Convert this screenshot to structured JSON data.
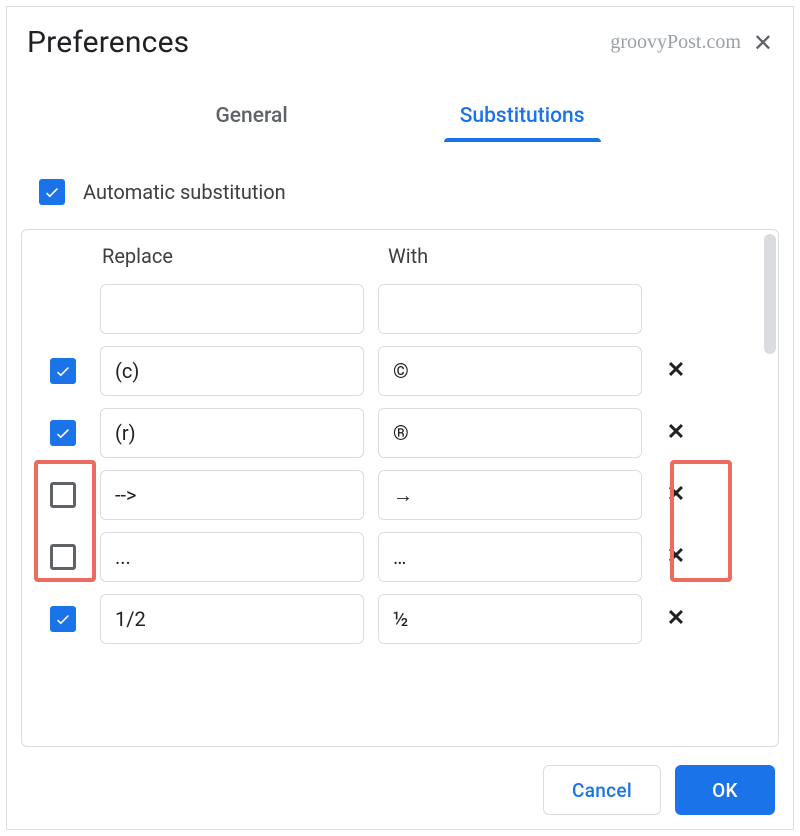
{
  "header": {
    "title": "Preferences",
    "watermark": "groovyPost.com"
  },
  "tabs": {
    "general": "General",
    "substitutions": "Substitutions"
  },
  "auto_sub": {
    "checked": true,
    "label": "Automatic substitution"
  },
  "columns": {
    "replace": "Replace",
    "with": "With"
  },
  "rows": [
    {
      "checked": null,
      "replace": "",
      "with": "",
      "deletable": false
    },
    {
      "checked": true,
      "replace": "(c)",
      "with": "©",
      "deletable": true
    },
    {
      "checked": true,
      "replace": "(r)",
      "with": "®",
      "deletable": true
    },
    {
      "checked": false,
      "replace": "-->",
      "with": "→",
      "deletable": true
    },
    {
      "checked": false,
      "replace": "...",
      "with": "…",
      "deletable": true
    },
    {
      "checked": true,
      "replace": "1/2",
      "with": "½",
      "deletable": true
    }
  ],
  "footer": {
    "cancel": "Cancel",
    "ok": "OK"
  }
}
